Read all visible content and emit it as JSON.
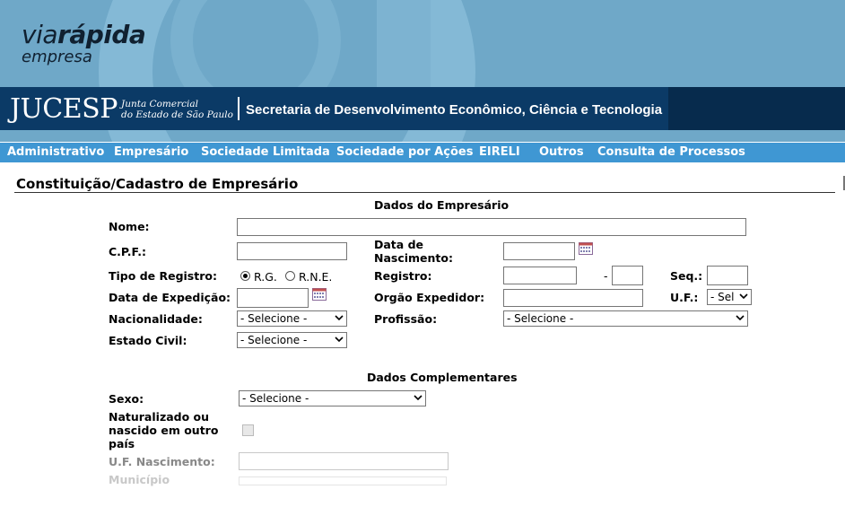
{
  "branding": {
    "logo_via": "via",
    "logo_rapida": "rápida",
    "logo_empresa": "empresa",
    "jucesp": "JUCESP",
    "junta_line1": "Junta Comercial",
    "junta_line2": "do Estado de São Paulo",
    "secretaria": "Secretaria de Desenvolvimento Econômico, Ciência e Tecnologia"
  },
  "nav": {
    "items": [
      "Administrativo",
      "Empresário",
      "Sociedade Limitada",
      "Sociedade por Ações",
      "EIRELI",
      "Outros",
      "Consulta de Processos"
    ]
  },
  "page": {
    "title": "Constituição/Cadastro de Empresário"
  },
  "dados_empresario": {
    "heading": "Dados do Empresário",
    "nome_label": "Nome:",
    "nome_value": "",
    "cpf_label": "C.P.F.:",
    "cpf_value": "",
    "nascimento_label_1": "Data de",
    "nascimento_label_2": "Nascimento:",
    "nascimento_value": "",
    "tipo_registro_label": "Tipo de Registro:",
    "tipo_rg": "R.G.",
    "tipo_rne": "R.N.E.",
    "registro_label": "Registro:",
    "registro_dash": "-",
    "seq_label": "Seq.:",
    "data_expedicao_label": "Data de Expedição:",
    "orgao_label": "Orgão Expedidor:",
    "uf_label": "U.F.:",
    "uf_select": "- Sel",
    "nacionalidade_label": "Nacionalidade:",
    "nacionalidade_select": "- Selecione -",
    "profissao_label": "Profissão:",
    "profissao_select": "- Selecione -",
    "estado_civil_label": "Estado Civil:",
    "estado_civil_select": "- Selecione -"
  },
  "dados_complementares": {
    "heading": "Dados Complementares",
    "sexo_label": "Sexo:",
    "sexo_select": "- Selecione -",
    "naturalizado_1": "Naturalizado ou",
    "naturalizado_2": "nascido em outro",
    "naturalizado_3": "país",
    "uf_nascimento_label": "U.F. Nascimento:",
    "municipio_label": "Município"
  }
}
